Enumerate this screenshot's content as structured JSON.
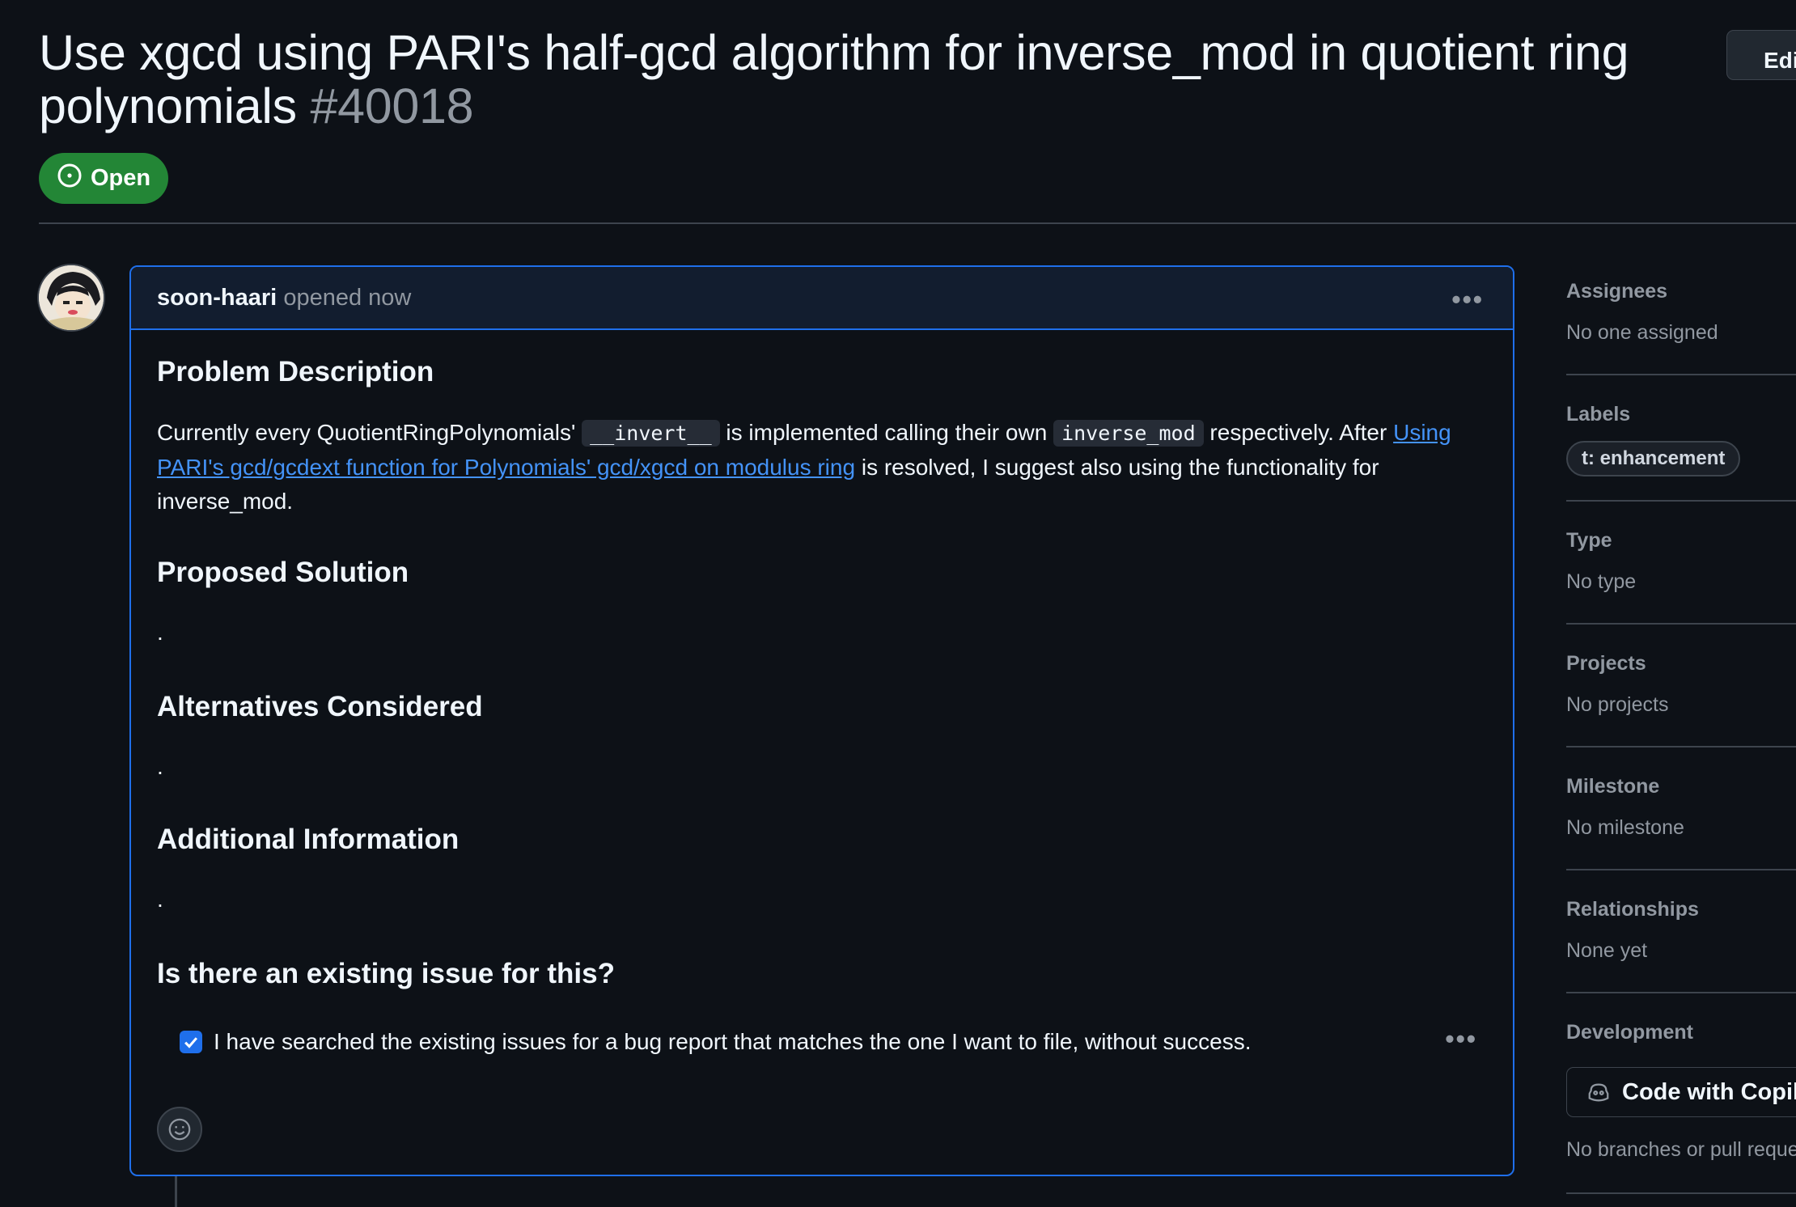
{
  "issue": {
    "title": "Use xgcd using PARI's half-gcd algorithm for inverse_mod in quotient ring polynomials",
    "number": "#40018",
    "state": "Open",
    "edit_label": "Edit"
  },
  "comment": {
    "author": "soon-haari",
    "time": "opened now",
    "sections": {
      "problem_heading": "Problem Description",
      "problem_text_1": "Currently every QuotientRingPolynomials' ",
      "problem_code_1": "__invert__",
      "problem_text_2": " is implemented calling their own ",
      "problem_code_2": "inverse_mod",
      "problem_text_3": " respectively. After ",
      "problem_link": "Using PARI's gcd/gcdext function for Polynomials' gcd/xgcd on modulus ring",
      "problem_text_4": " is resolved, I suggest also using the functionality for inverse_mod.",
      "solution_heading": "Proposed Solution",
      "solution_text": ".",
      "alternatives_heading": "Alternatives Considered",
      "alternatives_text": ".",
      "additional_heading": "Additional Information",
      "additional_text": ".",
      "existing_heading": "Is there an existing issue for this?",
      "checkbox_label": "I have searched the existing issues for a bug report that matches the one I want to file, without success.",
      "checkbox_checked": true
    }
  },
  "sidebar": {
    "assignees": {
      "title": "Assignees",
      "value": "No one assigned"
    },
    "labels": {
      "title": "Labels",
      "items": [
        "t: enhancement"
      ]
    },
    "type": {
      "title": "Type",
      "value": "No type"
    },
    "projects": {
      "title": "Projects",
      "value": "No projects"
    },
    "milestone": {
      "title": "Milestone",
      "value": "No milestone"
    },
    "relationships": {
      "title": "Relationships",
      "value": "None yet"
    },
    "development": {
      "title": "Development",
      "button": "Code with Copilot",
      "value": "No branches or pull requests"
    }
  },
  "colors": {
    "background": "#0d1117",
    "open_badge": "#238636",
    "accent": "#1f6feb",
    "link": "#4493f8"
  }
}
